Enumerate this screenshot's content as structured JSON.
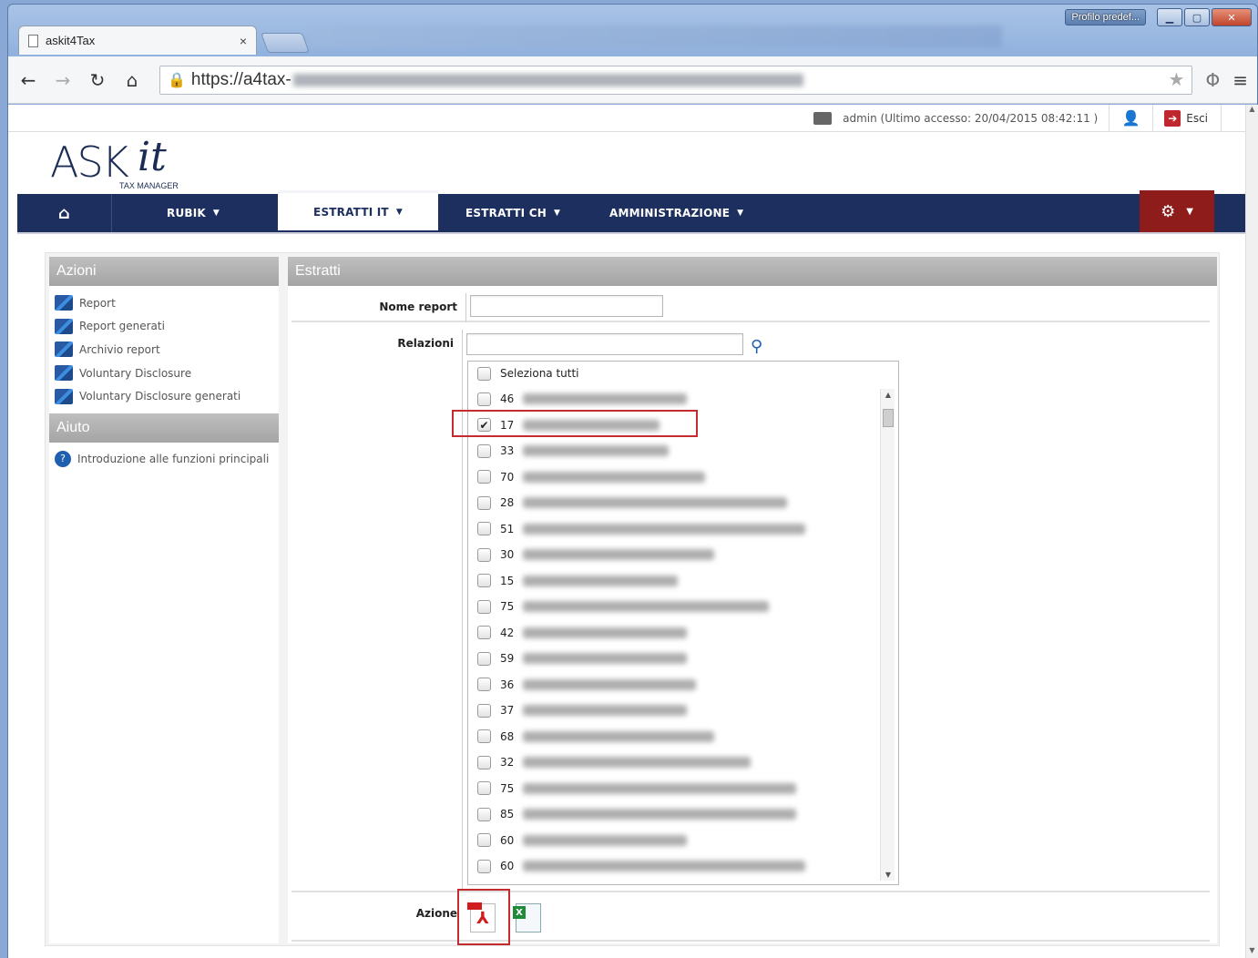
{
  "browser": {
    "profile_button": "Profilo predef...",
    "minimize": "▁",
    "maximize": "▢",
    "close": "✕",
    "tab_title": "askit4Tax",
    "tab_close": "×",
    "url": "https://a4tax-"
  },
  "userbar": {
    "user_info": "admin  (Ultimo accesso: 20/04/2015 08:42:11 )",
    "logout": "Esci"
  },
  "logo": {
    "ask": "ASK",
    "it": "it",
    "sub": "TAX MANAGER"
  },
  "nav": {
    "items": [
      {
        "label": "RUBIK"
      },
      {
        "label": "ESTRATTI IT"
      },
      {
        "label": "ESTRATTI CH"
      },
      {
        "label": "AMMINISTRAZIONE"
      }
    ],
    "active": "ESTRATTI IT"
  },
  "sidebar": {
    "azioni_title": "Azioni",
    "azioni_items": [
      "Report",
      "Report generati",
      "Archivio report",
      "Voluntary Disclosure",
      "Voluntary Disclosure generati"
    ],
    "aiuto_title": "Aiuto",
    "aiuto_items": [
      "Introduzione alle funzioni principali"
    ]
  },
  "form": {
    "title": "Estratti",
    "nome_report_label": "Nome report",
    "nome_report_value": "",
    "relazioni_label": "Relazioni",
    "relazioni_value": "",
    "select_all": "Seleziona tutti",
    "relazioni_list": [
      {
        "prefix": "46",
        "checked": false
      },
      {
        "prefix": "17",
        "checked": true
      },
      {
        "prefix": "33",
        "checked": false
      },
      {
        "prefix": "70",
        "checked": false
      },
      {
        "prefix": "28",
        "checked": false
      },
      {
        "prefix": "51",
        "checked": false
      },
      {
        "prefix": "30",
        "checked": false
      },
      {
        "prefix": "15",
        "checked": false
      },
      {
        "prefix": "75",
        "checked": false
      },
      {
        "prefix": "42",
        "checked": false
      },
      {
        "prefix": "59",
        "checked": false
      },
      {
        "prefix": "36",
        "checked": false
      },
      {
        "prefix": "37",
        "checked": false
      },
      {
        "prefix": "68",
        "checked": false
      },
      {
        "prefix": "32",
        "checked": false
      },
      {
        "prefix": "75",
        "checked": false
      },
      {
        "prefix": "85",
        "checked": false
      },
      {
        "prefix": "60",
        "checked": false
      },
      {
        "prefix": "60",
        "checked": false
      }
    ],
    "azione_label": "Azione"
  },
  "colors": {
    "navbar": "#1c2f5e",
    "settings": "#8e1c1a",
    "highlight": "#c52a2e",
    "panel_header": "#a4a4a4"
  }
}
